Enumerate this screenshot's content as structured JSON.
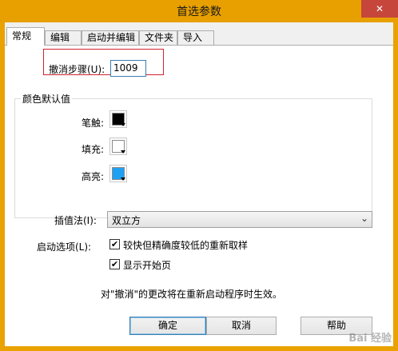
{
  "window": {
    "title": "首选参数",
    "close_label": "✕"
  },
  "tabs": [
    "常规",
    "编辑",
    "启动并编辑",
    "文件夹",
    "导入"
  ],
  "general": {
    "undo_steps_label": "撤消步骤(U):",
    "undo_steps_value": "1009",
    "color_group_label": "颜色默认值",
    "stroke_label": "笔触:",
    "fill_label": "填充:",
    "highlight_label": "高亮:",
    "stroke_color": "#000000",
    "fill_color": "#ffffff",
    "highlight_color": "#1ea1f2",
    "interpolation_label": "插值法(I):",
    "interpolation_value": "双立方",
    "startup_options_label": "启动选项(L):",
    "option_resample_label": "较快但精确度较低的重新取样",
    "option_resample_checked": true,
    "option_start_page_label": "显示开始页",
    "option_start_page_checked": true,
    "note": "对\"撤消\"的更改将在重新启动程序时生效。"
  },
  "buttons": {
    "ok": "确定",
    "cancel": "取消",
    "help": "帮助"
  },
  "watermark": "Bai 经验"
}
